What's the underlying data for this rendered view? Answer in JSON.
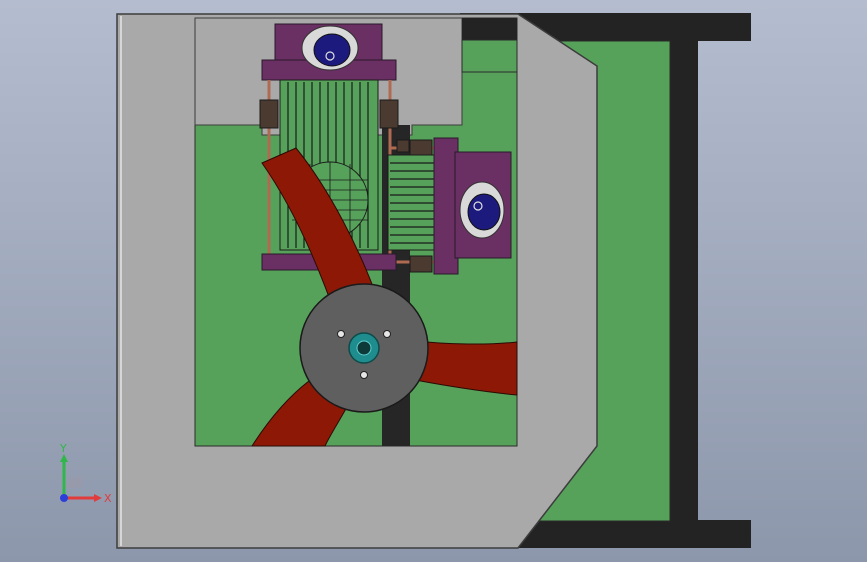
{
  "viewport": {
    "background_top": "#b4bdcf",
    "background_bottom": "#8d97ab"
  },
  "model": {
    "components": [
      "housing-frame",
      "green-base-plate",
      "rear-frame-bracket",
      "vertical-shaft-column",
      "upper-motor-mount",
      "right-motor-mount",
      "upper-grille",
      "right-grille",
      "round-grille",
      "fan-blade",
      "fan-hub"
    ],
    "colors": {
      "housing": "#a9a9a9",
      "housing_edge": "#3c3c3c",
      "base_plate": "#56a25a",
      "dark_frame": "#232323",
      "motor_mount": "#6a2f63",
      "motor_body": "#1d1a7e",
      "blade": "#8e1806",
      "hub": "#5f5f5f",
      "hub_ring": "#1f8d8d",
      "pipe": "#b06a52"
    }
  },
  "triad": {
    "y_label": "Y",
    "x_label": "X",
    "y_color": "#2fb74a",
    "x_color": "#e23b3b",
    "z_color": "#2c3fd6"
  }
}
